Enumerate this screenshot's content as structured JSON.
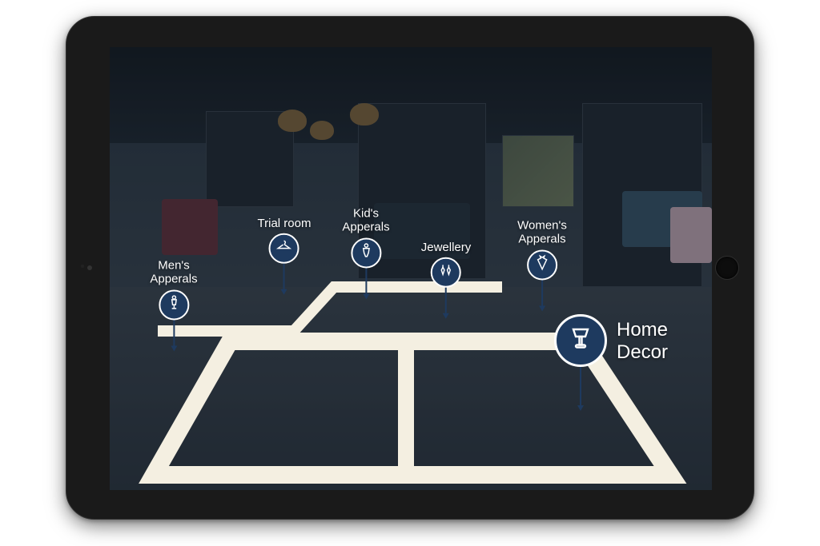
{
  "device": {
    "type": "tablet",
    "orientation": "landscape"
  },
  "colors": {
    "pin_bg": "#1e3a5f",
    "pin_border": "#ffffff",
    "path": "#f4efe1"
  },
  "waypoints": {
    "mens": {
      "label": "Men's\nApperals",
      "icon": "mannequin-icon"
    },
    "trial": {
      "label": "Trial room",
      "icon": "hanger-icon"
    },
    "kids": {
      "label": "Kid's\nApperals",
      "icon": "child-icon"
    },
    "jewellery": {
      "label": "Jewellery",
      "icon": "jewellery-icon"
    },
    "womens": {
      "label": "Women's\nApperals",
      "icon": "dress-icon"
    },
    "homedecor": {
      "label": "Home\nDecor",
      "icon": "lamp-icon"
    }
  }
}
